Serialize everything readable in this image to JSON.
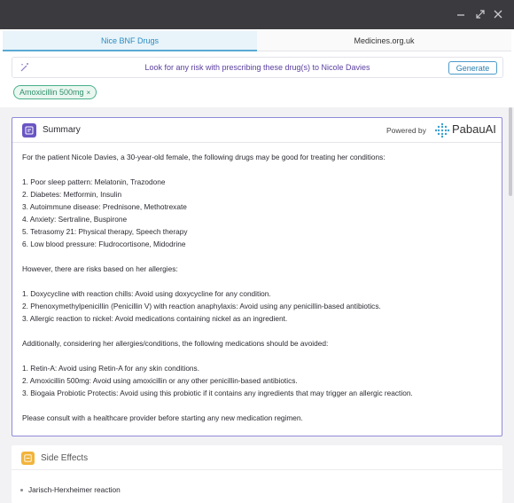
{
  "window": {
    "controls": [
      "minimize-icon",
      "restore-icon",
      "close-icon"
    ]
  },
  "tabs": [
    {
      "label": "Nice BNF Drugs",
      "active": true
    },
    {
      "label": "Medicines.org.uk",
      "active": false
    }
  ],
  "risk": {
    "prompt": "Look for any risk with prescribing these drug(s) to Nicole Davies",
    "button": "Generate"
  },
  "chips": [
    {
      "label": "Amoxicillin 500mg",
      "remove": "×"
    }
  ],
  "summary": {
    "title": "Summary",
    "powered_by": "Powered by",
    "brand": "PabauAI",
    "lines": [
      "For the patient Nicole Davies, a 30-year-old female, the following drugs may be good for treating her conditions:",
      "",
      "1. Poor sleep pattern: Melatonin, Trazodone",
      "2. Diabetes: Metformin, Insulin",
      "3. Autoimmune disease: Prednisone, Methotrexate",
      "4. Anxiety: Sertraline, Buspirone",
      "5. Tetrasomy 21: Physical therapy, Speech therapy",
      "6. Low blood pressure: Fludrocortisone, Midodrine",
      "",
      "However, there are risks based on her allergies:",
      "",
      "1. Doxycycline with reaction chills: Avoid using doxycycline for any condition.",
      "2. Phenoxymethylpenicillin (Penicillin V) with reaction anaphylaxis: Avoid using any penicillin-based antibiotics.",
      "3. Allergic reaction to nickel: Avoid medications containing nickel as an ingredient.",
      "",
      "Additionally, considering her allergies/conditions, the following medications should be avoided:",
      "",
      "1. Retin-A: Avoid using Retin-A for any skin conditions.",
      "2. Amoxicillin 500mg: Avoid using amoxicillin or any other penicillin-based antibiotics.",
      "3. Biogaia Probiotic Protectis: Avoid using this probiotic if it contains any ingredients that may trigger an allergic reaction.",
      "",
      "Please consult with a healthcare provider before starting any new medication regimen."
    ]
  },
  "side_effects": {
    "title": "Side Effects",
    "items": [
      "Jarisch-Herxheimer reaction"
    ]
  },
  "colors": {
    "titlebar": "#3b3b3f",
    "tab_active": "#2b8bc0",
    "prompt": "#5b3fa0",
    "summary_border": "#8e8ad8",
    "summary_icon": "#6a55c4",
    "chip": "#49b08a",
    "side_icon": "#f1b43c"
  }
}
